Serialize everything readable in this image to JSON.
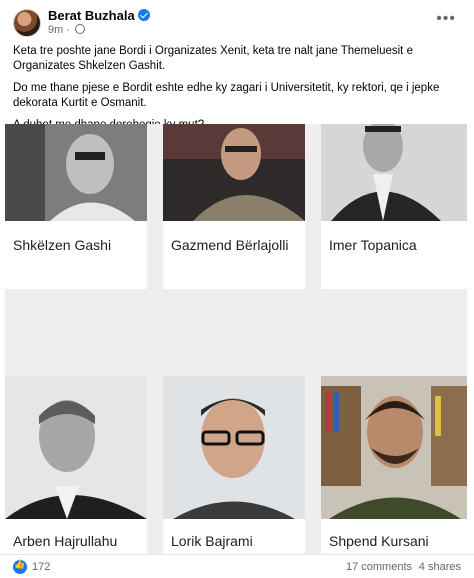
{
  "post": {
    "author": "Berat Buzhala",
    "time": "9m",
    "paragraphs": [
      "Keta tre poshte jane Bordi i Organizates Xenit, keta tre nalt jane Themeluesit e Organizates Shkelzen Gashit.",
      "Do me thane pjese e Bordit eshte edhe ky zagari i Universitetit, ky rektori, qe i jepke dekorata Kurtit e Osmanit.",
      "A duhet me dhane doreheqje ky mut?"
    ]
  },
  "people": [
    {
      "name": "Shkëlzen Gashi"
    },
    {
      "name": "Gazmend Bërlajolli"
    },
    {
      "name": "Imer Topanica"
    },
    {
      "name": "Arben Hajrullahu"
    },
    {
      "name": "Lorik Bajrami"
    },
    {
      "name": "Shpend Kursani"
    }
  ],
  "footer": {
    "likes": "172",
    "comments": "17 comments",
    "shares": "4 shares"
  },
  "colors": {
    "accent": "#1877f2",
    "panel": "#eeeeee"
  }
}
